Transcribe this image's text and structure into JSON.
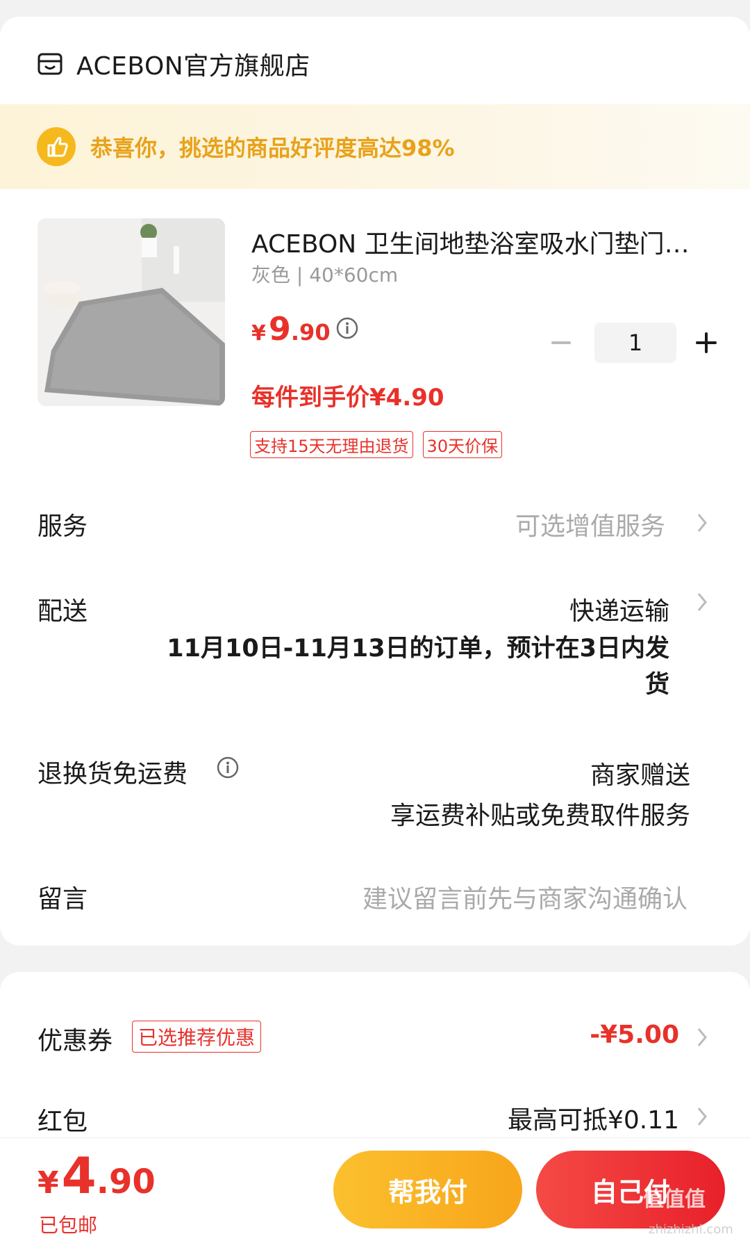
{
  "store": {
    "name": "ACEBON官方旗舰店",
    "icon": "store-icon"
  },
  "banner": {
    "text": "恭喜你，挑选的商品好评度高达98%",
    "icon": "thumbs-up-icon",
    "color": "#e8a21a"
  },
  "product": {
    "title": "ACEBON 卫生间地垫浴室吸水门垫门…",
    "spec": "灰色 | 40*60cm",
    "price_symbol": "¥",
    "price_int": "9",
    "price_dec": ".90",
    "net_price": "每件到手价¥4.90",
    "quantity": "1",
    "tags": [
      "支持15天无理由退货",
      "30天价保"
    ]
  },
  "rows": {
    "service": {
      "label": "服务",
      "value": "可选增值服务"
    },
    "delivery": {
      "label": "配送",
      "value": "快递运输",
      "note_line1": "11月10日-11月13日的订单，预计在3日内发",
      "note_line2": "货"
    },
    "return_shipping": {
      "label": "退换货免运费",
      "value": "商家赠送",
      "note": "享运费补贴或免费取件服务"
    },
    "message": {
      "label": "留言",
      "placeholder": "建议留言前先与商家沟通确认"
    }
  },
  "discounts": {
    "coupon": {
      "label": "优惠券",
      "badge": "已选推荐优惠",
      "value": "-¥5.00"
    },
    "red_packet": {
      "label": "红包",
      "value": "最高可抵¥0.11"
    }
  },
  "footer": {
    "total_symbol": "¥",
    "total_int": "4",
    "total_dec": ".90",
    "shipping_note": "已包邮",
    "help_pay_label": "帮我付",
    "self_pay_label": "自己付"
  },
  "watermark": {
    "text": "值值值",
    "sub": "zhizhizhi.com"
  },
  "colors": {
    "accent_red": "#e8312a",
    "accent_yellow": "#f8a51b"
  }
}
